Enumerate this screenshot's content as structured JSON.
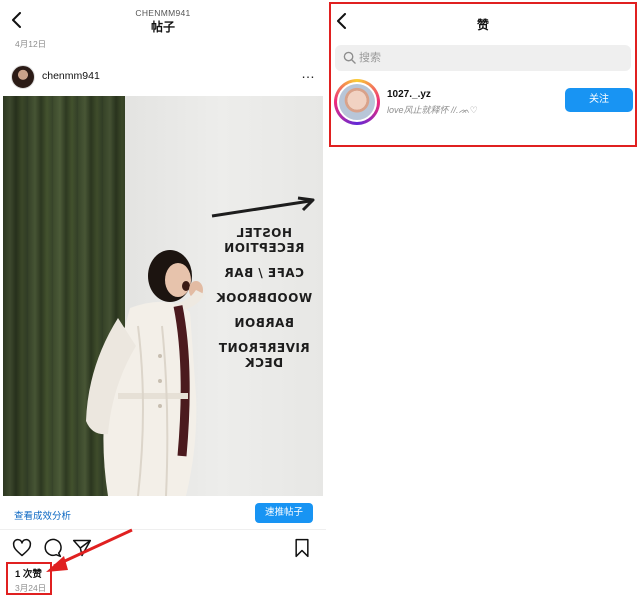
{
  "left": {
    "header": {
      "subtitle": "CHENMM941",
      "title": "帖子"
    },
    "post_date_top": "4月12日",
    "author": {
      "username": "chenmm941"
    },
    "more_icon": "…",
    "photo": {
      "wall_text": [
        "HOSTEL",
        "RECEPTION",
        "CAFE / BAR",
        "WOODBROOK",
        "BARBON",
        "RIVERFRONT",
        "DECK"
      ]
    },
    "insights_link": "查看成效分析",
    "boost_button": "速推帖子",
    "actions": [
      "heart-icon",
      "comment-icon",
      "share-icon",
      "bookmark-icon"
    ],
    "like_count": "1 次赞",
    "post_date_bottom": "3月24日",
    "annotation_color": "#e02020"
  },
  "right": {
    "header": {
      "title": "赞"
    },
    "search": {
      "placeholder": "搜索",
      "value": ""
    },
    "likers": [
      {
        "handle": "1027._.yz",
        "bio": "love风止就释怀 //.ᨏ♡",
        "follow_label": "关注"
      }
    ]
  },
  "colors": {
    "accent": "#1894f3",
    "link": "#0a66c2",
    "muted": "#8e8e8e",
    "highlight": "#e02020"
  }
}
